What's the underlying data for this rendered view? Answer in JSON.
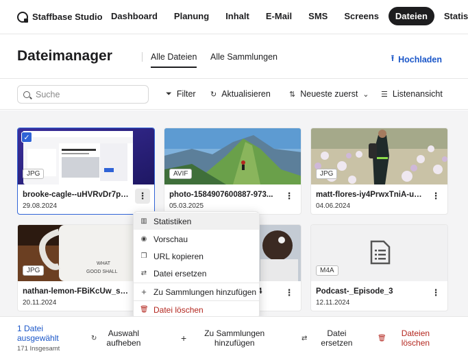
{
  "brand": {
    "name": "Staffbase Studio"
  },
  "nav": {
    "items": [
      "Dashboard",
      "Planung",
      "Inhalt",
      "E-Mail",
      "SMS",
      "Screens",
      "Dateien",
      "Statistiken"
    ],
    "active": "Dateien"
  },
  "header": {
    "title": "Dateimanager",
    "tabs": [
      "Alle Dateien",
      "Alle Sammlungen"
    ],
    "upload_label": "Hochladen"
  },
  "toolbar": {
    "search_placeholder": "Suche",
    "filter_label": "Filter",
    "refresh_label": "Aktualisieren",
    "sort_label": "Neueste zuerst",
    "view_label": "Listenansicht"
  },
  "files": [
    {
      "name": "brooke-cagle--uHVRvDr7pg...",
      "date": "29.08.2024",
      "type": "JPG",
      "selected": true
    },
    {
      "name": "photo-1584907600887-973...",
      "date": "05.03.2025",
      "type": "AVIF",
      "selected": false
    },
    {
      "name": "matt-flores-iy4PrwxTniA-un...",
      "date": "04.06.2024",
      "type": "JPG",
      "selected": false
    },
    {
      "name": "nathan-lemon-FBiKcUw_sQ...",
      "date": "20.11.2024",
      "type": "JPG",
      "selected": false
    },
    {
      "name": "4",
      "date": "",
      "type": "",
      "selected": false
    },
    {
      "name": "Podcast-_Episode_3",
      "date": "12.11.2024",
      "type": "M4A",
      "selected": false
    }
  ],
  "context_menu": {
    "items": [
      "Statistiken",
      "Vorschau",
      "URL kopieren",
      "Datei ersetzen",
      "Zu Sammlungen hinzufügen",
      "Datei löschen"
    ]
  },
  "bottom_bar": {
    "selected_line1": "1 Datei",
    "selected_line2": "ausgewählt",
    "total": "171 Insgesamt",
    "deselect_1": "Auswahl",
    "deselect_2": "aufheben",
    "add_1": "Zu Sammlungen",
    "add_2": "hinzufügen",
    "replace_1": "Datei",
    "replace_2": "ersetzen",
    "delete_1": "Dateien",
    "delete_2": "löschen"
  },
  "colors": {
    "accent": "#1a56c8",
    "danger": "#b3261e",
    "active_nav": "#1d1d1f",
    "selection": "#2f63d6"
  }
}
